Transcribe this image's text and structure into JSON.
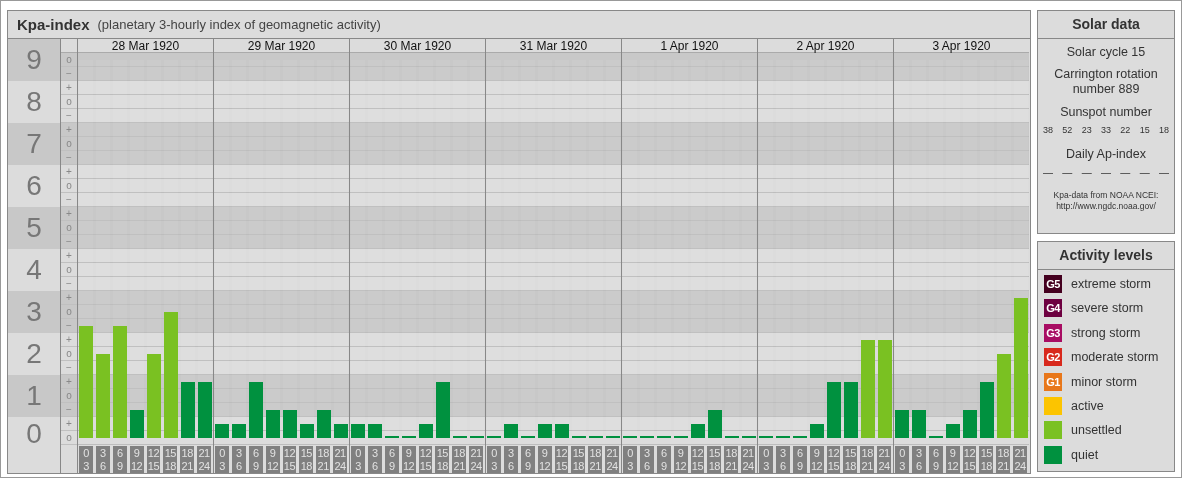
{
  "chart_panel": {
    "title": "Kpa-index",
    "subtitle": "(planetary 3-hourly index of geomagnetic activity)",
    "kp_scale": [
      {
        "value": "9",
        "marks": [
          "o",
          "−"
        ]
      },
      {
        "value": "8",
        "marks": [
          "+",
          "o",
          "−"
        ]
      },
      {
        "value": "7",
        "marks": [
          "+",
          "o",
          "−"
        ]
      },
      {
        "value": "6",
        "marks": [
          "+",
          "o",
          "−"
        ]
      },
      {
        "value": "5",
        "marks": [
          "+",
          "o",
          "−"
        ]
      },
      {
        "value": "4",
        "marks": [
          "+",
          "o",
          "−"
        ]
      },
      {
        "value": "3",
        "marks": [
          "+",
          "o",
          "−"
        ]
      },
      {
        "value": "2",
        "marks": [
          "+",
          "o",
          "−"
        ]
      },
      {
        "value": "1",
        "marks": [
          "+",
          "o",
          "−"
        ]
      },
      {
        "value": "0",
        "marks": [
          "+",
          "o"
        ]
      }
    ],
    "days": [
      {
        "date": "28 Mar 1920",
        "bars": [
          {
            "from": "0",
            "to": "3",
            "level": 0.296,
            "color": "#7ac122"
          },
          {
            "from": "3",
            "to": "6",
            "level": 0.222,
            "color": "#7ac122"
          },
          {
            "from": "6",
            "to": "9",
            "level": 0.296,
            "color": "#7ac122"
          },
          {
            "from": "9",
            "to": "12",
            "level": 0.074,
            "color": "#00913f"
          },
          {
            "from": "12",
            "to": "15",
            "level": 0.222,
            "color": "#7ac122"
          },
          {
            "from": "15",
            "to": "18",
            "level": 0.333,
            "color": "#7ac122"
          },
          {
            "from": "18",
            "to": "21",
            "level": 0.148,
            "color": "#00913f"
          },
          {
            "from": "21",
            "to": "24",
            "level": 0.148,
            "color": "#00913f"
          }
        ]
      },
      {
        "date": "29 Mar 1920",
        "bars": [
          {
            "from": "0",
            "to": "3",
            "level": 0.037,
            "color": "#00913f"
          },
          {
            "from": "3",
            "to": "6",
            "level": 0.037,
            "color": "#00913f"
          },
          {
            "from": "6",
            "to": "9",
            "level": 0.148,
            "color": "#00913f"
          },
          {
            "from": "9",
            "to": "12",
            "level": 0.074,
            "color": "#00913f"
          },
          {
            "from": "12",
            "to": "15",
            "level": 0.074,
            "color": "#00913f"
          },
          {
            "from": "15",
            "to": "18",
            "level": 0.037,
            "color": "#00913f"
          },
          {
            "from": "18",
            "to": "21",
            "level": 0.074,
            "color": "#00913f"
          },
          {
            "from": "21",
            "to": "24",
            "level": 0.037,
            "color": "#00913f"
          }
        ]
      },
      {
        "date": "30 Mar 1920",
        "bars": [
          {
            "from": "0",
            "to": "3",
            "level": 0.037,
            "color": "#00913f"
          },
          {
            "from": "3",
            "to": "6",
            "level": 0.037,
            "color": "#00913f"
          },
          {
            "from": "6",
            "to": "9",
            "level": 0,
            "color": "#00913f"
          },
          {
            "from": "9",
            "to": "12",
            "level": 0,
            "color": "#00913f"
          },
          {
            "from": "12",
            "to": "15",
            "level": 0.037,
            "color": "#00913f"
          },
          {
            "from": "15",
            "to": "18",
            "level": 0.148,
            "color": "#00913f"
          },
          {
            "from": "18",
            "to": "21",
            "level": 0,
            "color": "#00913f"
          },
          {
            "from": "21",
            "to": "24",
            "level": 0,
            "color": "#00913f"
          }
        ]
      },
      {
        "date": "31 Mar 1920",
        "bars": [
          {
            "from": "0",
            "to": "3",
            "level": 0,
            "color": "#00913f"
          },
          {
            "from": "3",
            "to": "6",
            "level": 0.037,
            "color": "#00913f"
          },
          {
            "from": "6",
            "to": "9",
            "level": 0,
            "color": "#00913f"
          },
          {
            "from": "9",
            "to": "12",
            "level": 0.037,
            "color": "#00913f"
          },
          {
            "from": "12",
            "to": "15",
            "level": 0.037,
            "color": "#00913f"
          },
          {
            "from": "15",
            "to": "18",
            "level": 0,
            "color": "#00913f"
          },
          {
            "from": "18",
            "to": "21",
            "level": 0,
            "color": "#00913f"
          },
          {
            "from": "21",
            "to": "24",
            "level": 0,
            "color": "#00913f"
          }
        ]
      },
      {
        "date": "1 Apr 1920",
        "bars": [
          {
            "from": "0",
            "to": "3",
            "level": 0,
            "color": "#00913f"
          },
          {
            "from": "3",
            "to": "6",
            "level": 0,
            "color": "#00913f"
          },
          {
            "from": "6",
            "to": "9",
            "level": 0,
            "color": "#00913f"
          },
          {
            "from": "9",
            "to": "12",
            "level": 0,
            "color": "#00913f"
          },
          {
            "from": "12",
            "to": "15",
            "level": 0.037,
            "color": "#00913f"
          },
          {
            "from": "15",
            "to": "18",
            "level": 0.074,
            "color": "#00913f"
          },
          {
            "from": "18",
            "to": "21",
            "level": 0,
            "color": "#00913f"
          },
          {
            "from": "21",
            "to": "24",
            "level": 0,
            "color": "#00913f"
          }
        ]
      },
      {
        "date": "2 Apr 1920",
        "bars": [
          {
            "from": "0",
            "to": "3",
            "level": 0,
            "color": "#00913f"
          },
          {
            "from": "3",
            "to": "6",
            "level": 0,
            "color": "#00913f"
          },
          {
            "from": "6",
            "to": "9",
            "level": 0,
            "color": "#00913f"
          },
          {
            "from": "9",
            "to": "12",
            "level": 0.037,
            "color": "#00913f"
          },
          {
            "from": "12",
            "to": "15",
            "level": 0.148,
            "color": "#00913f"
          },
          {
            "from": "15",
            "to": "18",
            "level": 0.148,
            "color": "#00913f"
          },
          {
            "from": "18",
            "to": "21",
            "level": 0.259,
            "color": "#7ac122"
          },
          {
            "from": "21",
            "to": "24",
            "level": 0.259,
            "color": "#7ac122"
          }
        ]
      },
      {
        "date": "3 Apr 1920",
        "bars": [
          {
            "from": "0",
            "to": "3",
            "level": 0.074,
            "color": "#00913f"
          },
          {
            "from": "3",
            "to": "6",
            "level": 0.074,
            "color": "#00913f"
          },
          {
            "from": "6",
            "to": "9",
            "level": 0,
            "color": "#00913f"
          },
          {
            "from": "9",
            "to": "12",
            "level": 0.037,
            "color": "#00913f"
          },
          {
            "from": "12",
            "to": "15",
            "level": 0.074,
            "color": "#00913f"
          },
          {
            "from": "15",
            "to": "18",
            "level": 0.148,
            "color": "#00913f"
          },
          {
            "from": "18",
            "to": "21",
            "level": 0.222,
            "color": "#7ac122"
          },
          {
            "from": "21",
            "to": "24",
            "level": 0.37,
            "color": "#7ac122"
          }
        ]
      }
    ]
  },
  "solar_data": {
    "title": "Solar data",
    "solar_cycle": "Solar cycle 15",
    "carrington_rotation": "Carrington rotation number 889",
    "sunspot_heading": "Sunspot number",
    "sunspot_numbers": [
      "38",
      "52",
      "23",
      "33",
      "22",
      "15",
      "18"
    ],
    "ap_heading": "Daily Ap-index",
    "ap_values": [
      "—",
      "—",
      "—",
      "—",
      "—",
      "—",
      "—"
    ],
    "source_lines": [
      "Kpa-data from NOAA NCEI:",
      "http://www.ngdc.noaa.gov/"
    ]
  },
  "activity_levels": {
    "title": "Activity levels",
    "items": [
      {
        "badge": "G5",
        "label": "extreme storm",
        "color": "#44001f"
      },
      {
        "badge": "G4",
        "label": "severe storm",
        "color": "#6d0040"
      },
      {
        "badge": "G3",
        "label": "strong storm",
        "color": "#a80d63"
      },
      {
        "badge": "G2",
        "label": "moderate storm",
        "color": "#d8291d"
      },
      {
        "badge": "G1",
        "label": "minor storm",
        "color": "#e8771a"
      },
      {
        "label": "active",
        "color": "#fcc400"
      },
      {
        "label": "unsettled",
        "color": "#7ac122"
      },
      {
        "label": "quiet",
        "color": "#00913f"
      }
    ]
  }
}
